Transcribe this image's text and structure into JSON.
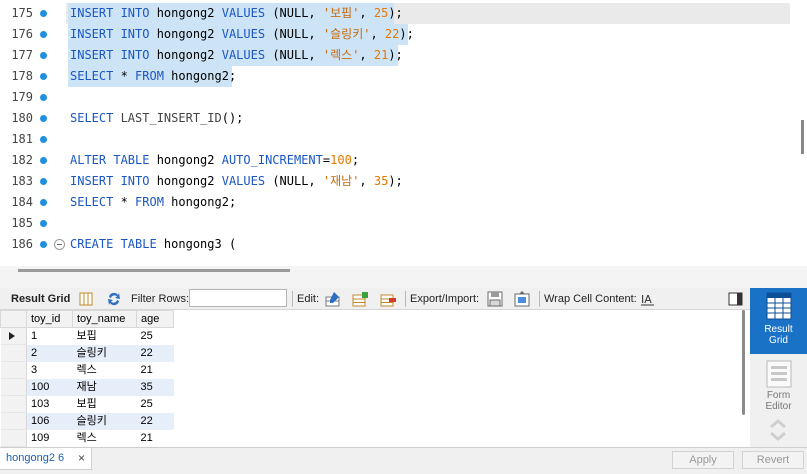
{
  "editor": {
    "lines": [
      {
        "num": "175",
        "tokens": [
          [
            "kw",
            "INSERT INTO "
          ],
          [
            "id",
            "hongong2 "
          ],
          [
            "kw",
            "VALUES "
          ],
          [
            "id",
            "(NULL, "
          ],
          [
            "str",
            "'보핍'"
          ],
          [
            "id",
            ", "
          ],
          [
            "num",
            "25"
          ],
          [
            "id",
            ");"
          ]
        ]
      },
      {
        "num": "176",
        "tokens": [
          [
            "kw",
            "INSERT INTO "
          ],
          [
            "id",
            "hongong2 "
          ],
          [
            "kw",
            "VALUES "
          ],
          [
            "id",
            "(NULL, "
          ],
          [
            "str",
            "'슬링키'"
          ],
          [
            "id",
            ", "
          ],
          [
            "num",
            "22"
          ],
          [
            "id",
            ");"
          ]
        ]
      },
      {
        "num": "177",
        "tokens": [
          [
            "kw",
            "INSERT INTO "
          ],
          [
            "id",
            "hongong2 "
          ],
          [
            "kw",
            "VALUES "
          ],
          [
            "id",
            "(NULL, "
          ],
          [
            "str",
            "'렉스'"
          ],
          [
            "id",
            ", "
          ],
          [
            "num",
            "21"
          ],
          [
            "id",
            ");"
          ]
        ]
      },
      {
        "num": "178",
        "tokens": [
          [
            "kw",
            "SELECT "
          ],
          [
            "id",
            "* "
          ],
          [
            "kw",
            "FROM "
          ],
          [
            "id",
            "hongong2;"
          ]
        ]
      },
      {
        "num": "179",
        "tokens": []
      },
      {
        "num": "180",
        "tokens": [
          [
            "kw",
            "SELECT "
          ],
          [
            "fn",
            "LAST_INSERT_ID"
          ],
          [
            "id",
            "();"
          ]
        ]
      },
      {
        "num": "181",
        "tokens": []
      },
      {
        "num": "182",
        "tokens": [
          [
            "kw",
            "ALTER TABLE "
          ],
          [
            "id",
            "hongong2 "
          ],
          [
            "kw",
            "AUTO_INCREMENT"
          ],
          [
            "id",
            "="
          ],
          [
            "num",
            "100"
          ],
          [
            "id",
            ";"
          ]
        ]
      },
      {
        "num": "183",
        "tokens": [
          [
            "kw",
            "INSERT INTO "
          ],
          [
            "id",
            "hongong2 "
          ],
          [
            "kw",
            "VALUES "
          ],
          [
            "id",
            "(NULL, "
          ],
          [
            "str",
            "'재남'"
          ],
          [
            "id",
            ", "
          ],
          [
            "num",
            "35"
          ],
          [
            "id",
            ");"
          ]
        ]
      },
      {
        "num": "184",
        "tokens": [
          [
            "kw",
            "SELECT "
          ],
          [
            "id",
            "* "
          ],
          [
            "kw",
            "FROM "
          ],
          [
            "id",
            "hongong2;"
          ]
        ]
      },
      {
        "num": "185",
        "tokens": []
      },
      {
        "num": "186",
        "tokens": [
          [
            "kw",
            "CREATE TABLE "
          ],
          [
            "id",
            "hongong3 ("
          ]
        ]
      }
    ]
  },
  "toolbar": {
    "result_grid_label": "Result Grid",
    "filter_rows_label": "Filter Rows:",
    "filter_value": "",
    "edit_label": "Edit:",
    "export_import_label": "Export/Import:",
    "wrap_label": "Wrap Cell Content:"
  },
  "grid": {
    "columns": [
      "toy_id",
      "toy_name",
      "age"
    ],
    "rows": [
      [
        "1",
        "보핍",
        "25"
      ],
      [
        "2",
        "슬링키",
        "22"
      ],
      [
        "3",
        "렉스",
        "21"
      ],
      [
        "100",
        "재남",
        "35"
      ],
      [
        "103",
        "보핍",
        "25"
      ],
      [
        "106",
        "슬링키",
        "22"
      ],
      [
        "109",
        "렉스",
        "21"
      ]
    ]
  },
  "side_panel": {
    "result_grid": "Result Grid",
    "form_editor": "Form Editor"
  },
  "bottom": {
    "tab_label": "hongong2 6",
    "apply_label": "Apply",
    "revert_label": "Revert"
  }
}
